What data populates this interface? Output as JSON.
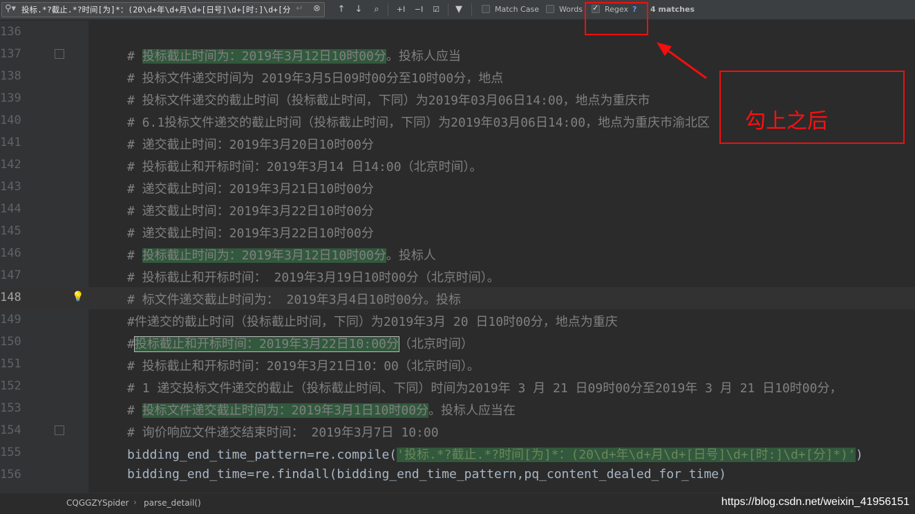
{
  "search": {
    "query": "投标.*?截止.*?时间[为]*：(20\\d+年\\d+月\\d+[日号]\\d+[时:]\\d+[分]*)",
    "match_case_label": "Match Case",
    "words_label": "Words",
    "regex_label": "Regex",
    "regex_help": "?",
    "matches_text": "4 matches",
    "match_case_checked": false,
    "words_checked": false,
    "regex_checked": true
  },
  "editor": {
    "current_line": 148,
    "lines": [
      {
        "num": "136",
        "text": ""
      },
      {
        "num": "137",
        "pre": "# ",
        "match": "投标截止时间为：2019年3月12日10时00分",
        "post": "。投标人应当"
      },
      {
        "num": "138",
        "text": "# 投标文件递交时间为 2019年3月5日09时00分至10时00分，地点"
      },
      {
        "num": "139",
        "text": "# 投标文件递交的截止时间（投标截止时间，下同）为2019年03月06日14:00，地点为重庆市"
      },
      {
        "num": "140",
        "text": "# 6.1投标文件递交的截止时间（投标截止时间，下同）为2019年03月06日14:00，地点为重庆市渝北区"
      },
      {
        "num": "141",
        "text": "# 递交截止时间：2019年3月20日10时00分"
      },
      {
        "num": "142",
        "text": "# 投标截止和开标时间：2019年3月14 日14:00（北京时间）。"
      },
      {
        "num": "143",
        "text": "# 递交截止时间：2019年3月21日10时00分"
      },
      {
        "num": "144",
        "text": "# 递交截止时间：2019年3月22日10时00分"
      },
      {
        "num": "145",
        "text": "# 递交截止时间：2019年3月22日10时00分"
      },
      {
        "num": "146",
        "pre": "# ",
        "match": "投标截止时间为：2019年3月12日10时00分",
        "post": "。投标人"
      },
      {
        "num": "147",
        "text": "# 投标截止和开标时间： 2019年3月19日10时00分（北京时间）。"
      },
      {
        "num": "148",
        "text": "# 标文件递交截止时间为： 2019年3月4日10时00分。投标"
      },
      {
        "num": "149",
        "text": "#件递交的截止时间（投标截止时间，下同）为2019年3月 20  日10时00分，地点为重庆"
      },
      {
        "num": "150",
        "pre": "#",
        "match": "投标截止和开标时间：2019年3月22日10:00分",
        "post": "（北京时间）"
      },
      {
        "num": "151",
        "text": "# 投标截止和开标时间：2019年3月21日10：00（北京时间）。"
      },
      {
        "num": "152",
        "text": "# 1 递交投标文件递交的截止（投标截止时间、下同）时间为2019年 3 月 21 日09时00分至2019年 3 月 21 日10时00分，"
      },
      {
        "num": "153",
        "pre": "# ",
        "match": "投标文件递交截止时间为：2019年3月1日10时00分",
        "post": "。投标人应当在"
      },
      {
        "num": "154",
        "text": "# 询价响应文件递交结束时间： 2019年3月7日 10:00"
      },
      {
        "num": "155",
        "code_pre": "bidding_end_time_pattern=re.compile(",
        "code_str": "'投标.*?截止.*?时间[为]*：(20\\d+年\\d+月\\d+[日号]\\d+[时:]\\d+[分]*)'",
        "code_post": ")"
      },
      {
        "num": "156",
        "code_pre": "bidding_end_time=re.findall(bidding_end_time_pattern,pq_content_dealed_for_time)"
      }
    ]
  },
  "breadcrumb": {
    "class_name": "CQGGZYSpider",
    "separator": "›",
    "method_name": "parse_detail()"
  },
  "watermark": "https://blog.csdn.net/weixin_41956151",
  "annotation": {
    "text": "勾上之后"
  },
  "colors": {
    "accent_red": "#f20f0f",
    "match_bg": "#32593d",
    "comment": "#808080"
  }
}
